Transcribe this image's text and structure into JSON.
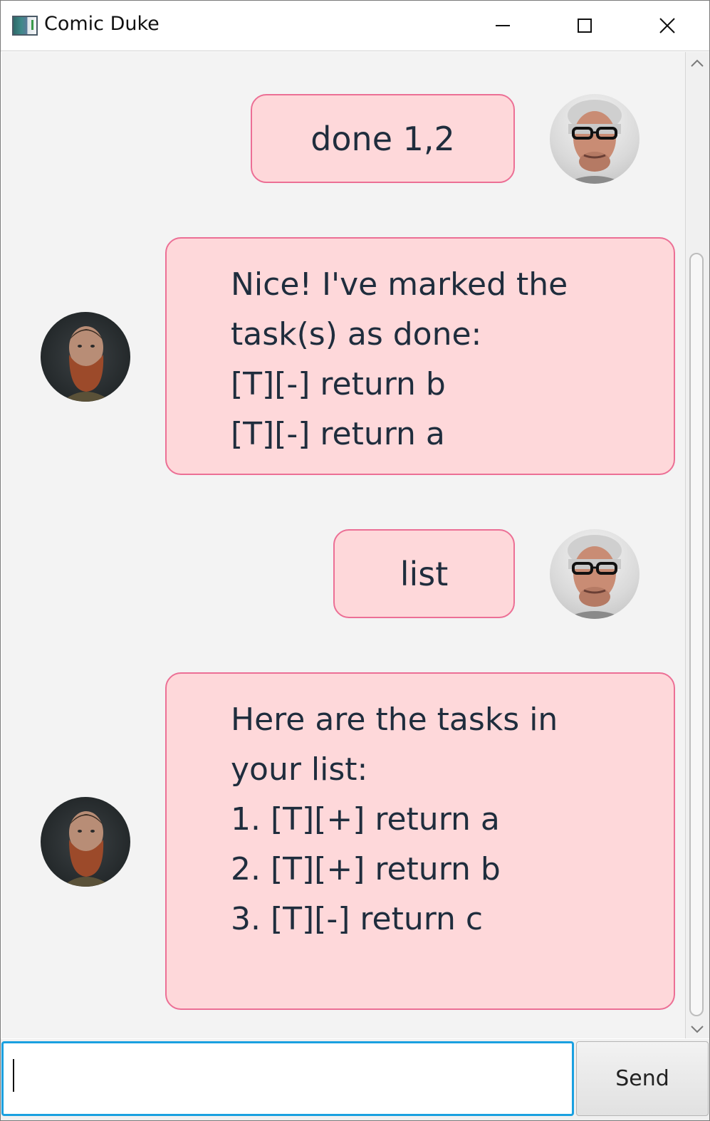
{
  "window": {
    "title": "Comic Duke"
  },
  "messages": [
    {
      "sender": "user",
      "text": "done 1,2"
    },
    {
      "sender": "bot",
      "text": "Nice! I've marked the\ntask(s) as done:\n[T][-] return b\n[T][-] return a"
    },
    {
      "sender": "user",
      "text": "list"
    },
    {
      "sender": "bot",
      "text": "Here are the tasks in\nyour list:\n1. [T][+] return a\n2. [T][+] return b\n3. [T][-] return c"
    }
  ],
  "input": {
    "value": "",
    "placeholder": ""
  },
  "send_label": "Send",
  "colors": {
    "bubble_fill": "#fed8da",
    "bubble_border": "#ec6f95",
    "text": "#1f2d3d",
    "input_focus": "#1aa0e0",
    "chat_background": "#f3f3f3"
  },
  "icons": [
    "app-icon",
    "minimize-icon",
    "maximize-icon",
    "close-icon",
    "scroll-up-icon",
    "scroll-down-icon"
  ]
}
